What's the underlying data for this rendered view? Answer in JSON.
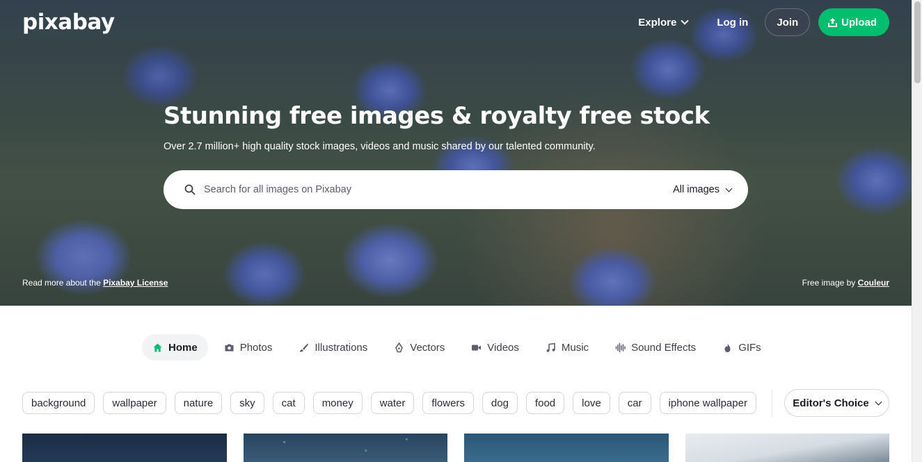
{
  "header": {
    "logo": "pixabay",
    "nav": {
      "explore": "Explore",
      "login": "Log in",
      "join": "Join",
      "upload": "Upload"
    }
  },
  "hero": {
    "title": "Stunning free images & royalty free stock",
    "subtitle": "Over 2.7 million+ high quality stock images, videos and music shared by our talented community.",
    "search": {
      "placeholder": "Search for all images on Pixabay",
      "type_selected": "All images"
    },
    "license_prefix": "Read more about the ",
    "license_link": "Pixabay License",
    "credit_prefix": "Free image by ",
    "credit_author": "Couleur"
  },
  "tabs": [
    {
      "label": "Home",
      "icon": "home-icon",
      "active": true
    },
    {
      "label": "Photos",
      "icon": "camera-icon"
    },
    {
      "label": "Illustrations",
      "icon": "brush-icon"
    },
    {
      "label": "Vectors",
      "icon": "pen-nib-icon"
    },
    {
      "label": "Videos",
      "icon": "video-camera-icon"
    },
    {
      "label": "Music",
      "icon": "music-note-icon"
    },
    {
      "label": "Sound Effects",
      "icon": "waveform-icon"
    },
    {
      "label": "GIFs",
      "icon": "flame-icon"
    }
  ],
  "tags": [
    "background",
    "wallpaper",
    "nature",
    "sky",
    "cat",
    "money",
    "water",
    "flowers",
    "dog",
    "food",
    "love",
    "car",
    "iphone wallpaper"
  ],
  "sort": {
    "label": "Editor's Choice"
  },
  "colors": {
    "accent": "#02be6e",
    "join_bg": "#3c4250",
    "text": "#191b26"
  }
}
